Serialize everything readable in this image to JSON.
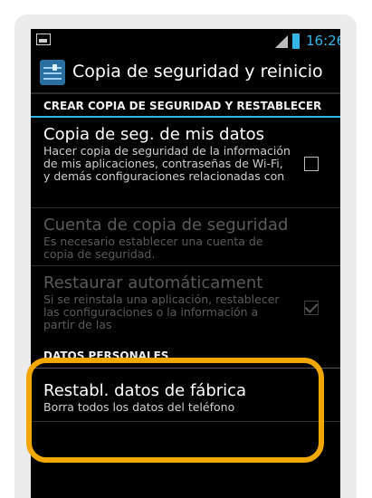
{
  "statusbar": {
    "time": "16:26",
    "accent": "#33b5e5"
  },
  "actionbar": {
    "title": "Copia de seguridad y reinicio",
    "icon": "settings-sliders-icon"
  },
  "sections": [
    {
      "header": "CREAR COPIA DE SEGURIDAD Y RESTABLECER",
      "items": [
        {
          "title": "Copia de seg. de mis datos",
          "summary": "Hacer copia de seguridad de la información de mis aplicaciones, contraseñas de Wi-Fi, y demás configuraciones relacionadas con",
          "checkbox": false,
          "enabled": true
        },
        {
          "title": "Cuenta de copia de seguridad",
          "summary": "Es necesario establecer una cuenta de copia de seguridad.",
          "enabled": false
        },
        {
          "title": "Restaurar automáticament",
          "summary": "Si se reinstala una aplicación, restablecer las configuraciones o la información a partir de las",
          "checkbox": true,
          "enabled": false
        }
      ]
    },
    {
      "header": "DATOS PERSONALES",
      "items": [
        {
          "title": "Restabl. datos de fábrica",
          "summary": "Borra todos los datos del teléfono",
          "enabled": true
        }
      ]
    }
  ],
  "highlight_color": "#f2a800"
}
